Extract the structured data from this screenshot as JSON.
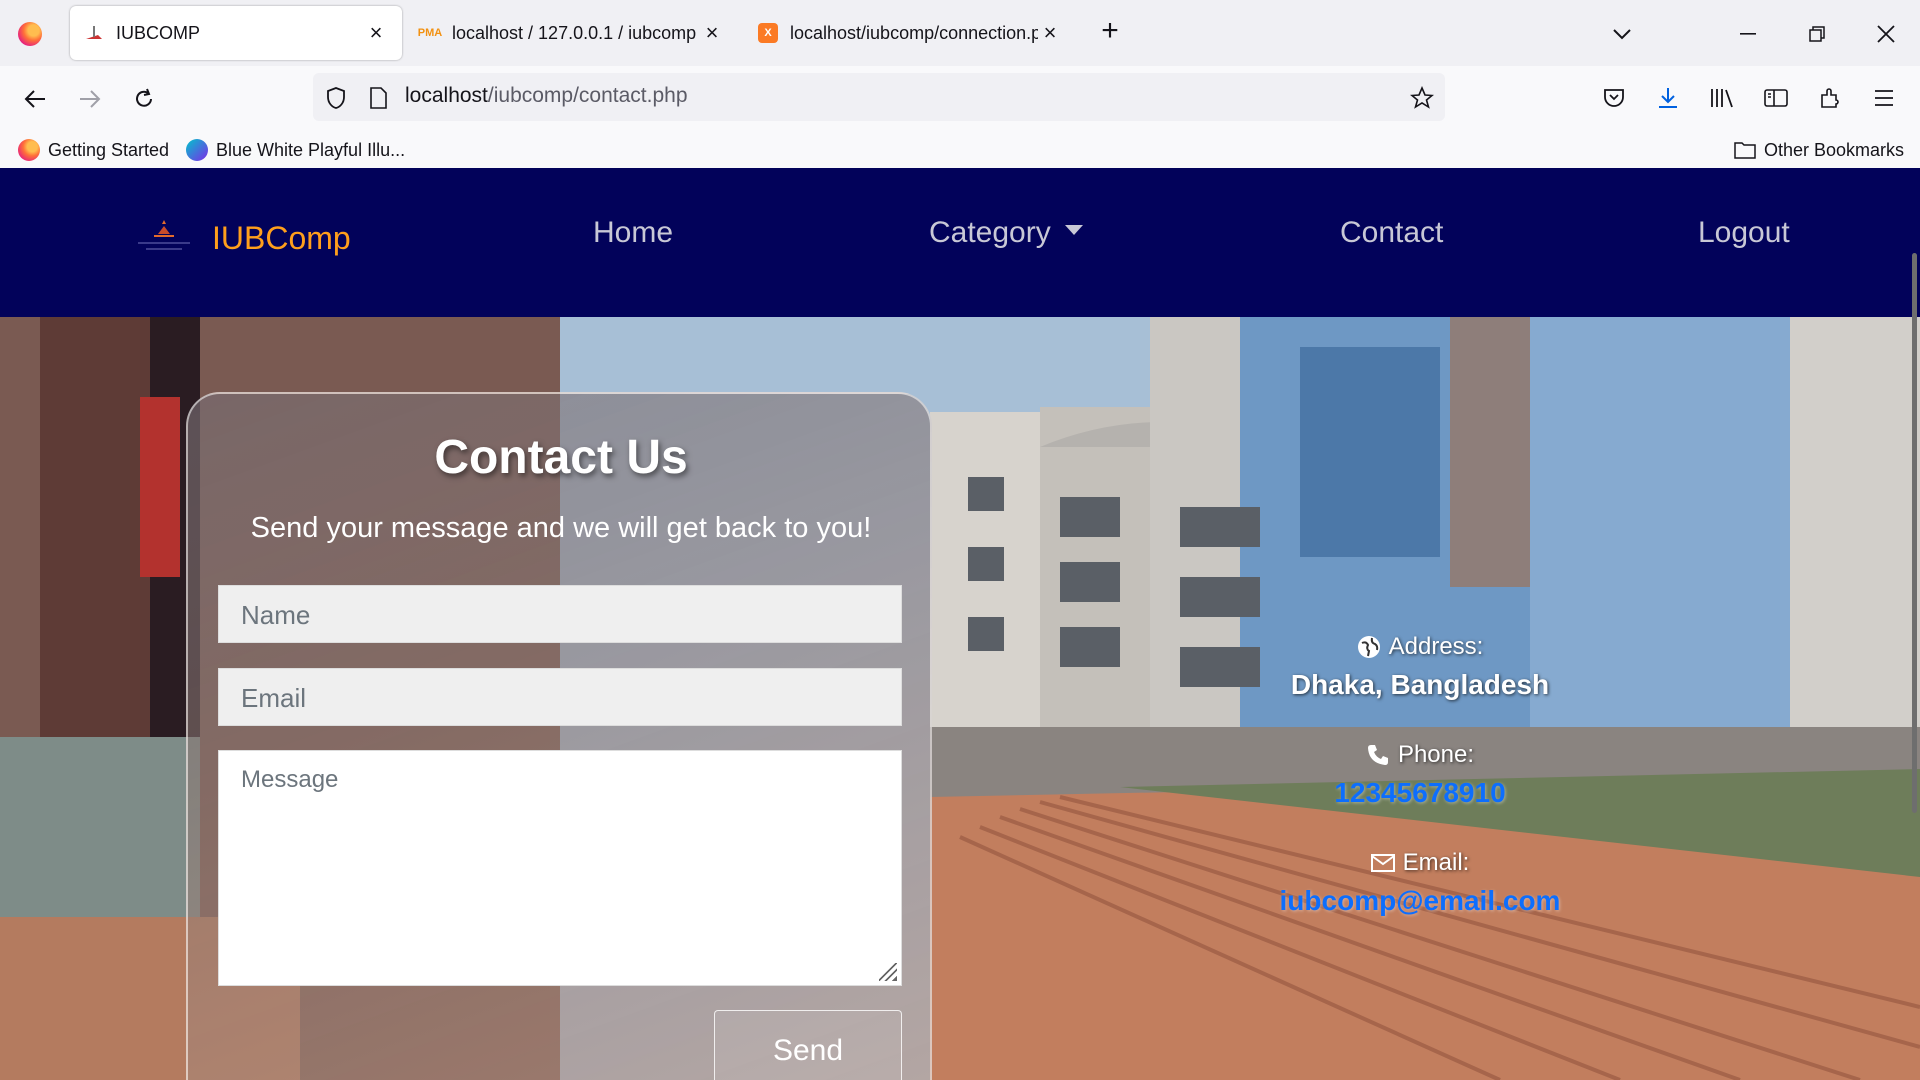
{
  "browser": {
    "tabs": [
      {
        "title": "IUBCOMP",
        "active": true
      },
      {
        "title": "localhost / 127.0.0.1 / iubcomp",
        "active": false
      },
      {
        "title": "localhost/iubcomp/connection.php",
        "active": false
      }
    ],
    "url_host": "localhost",
    "url_path": "/iubcomp/contact.php",
    "bookmarks": [
      "Getting Started",
      "Blue White Playful Illu..."
    ],
    "other_bookmarks": "Other Bookmarks"
  },
  "site": {
    "brand": "IUBComp",
    "nav": {
      "home": "Home",
      "category": "Category",
      "contact": "Contact",
      "logout": "Logout"
    }
  },
  "contact": {
    "title": "Contact Us",
    "subtitle": "Send your message and we will get back to you!",
    "name_placeholder": "Name",
    "email_placeholder": "Email",
    "message_placeholder": "Message",
    "send_label": "Send"
  },
  "info": {
    "address_label": "Address:",
    "address_value": "Dhaka, Bangladesh",
    "phone_label": "Phone:",
    "phone_value": "12345678910",
    "email_label": "Email:",
    "email_value": "iubcomp@email.com"
  },
  "colors": {
    "navbar_bg": "#02025a",
    "brand": "#ff9f1c",
    "link": "#0d6efd"
  }
}
